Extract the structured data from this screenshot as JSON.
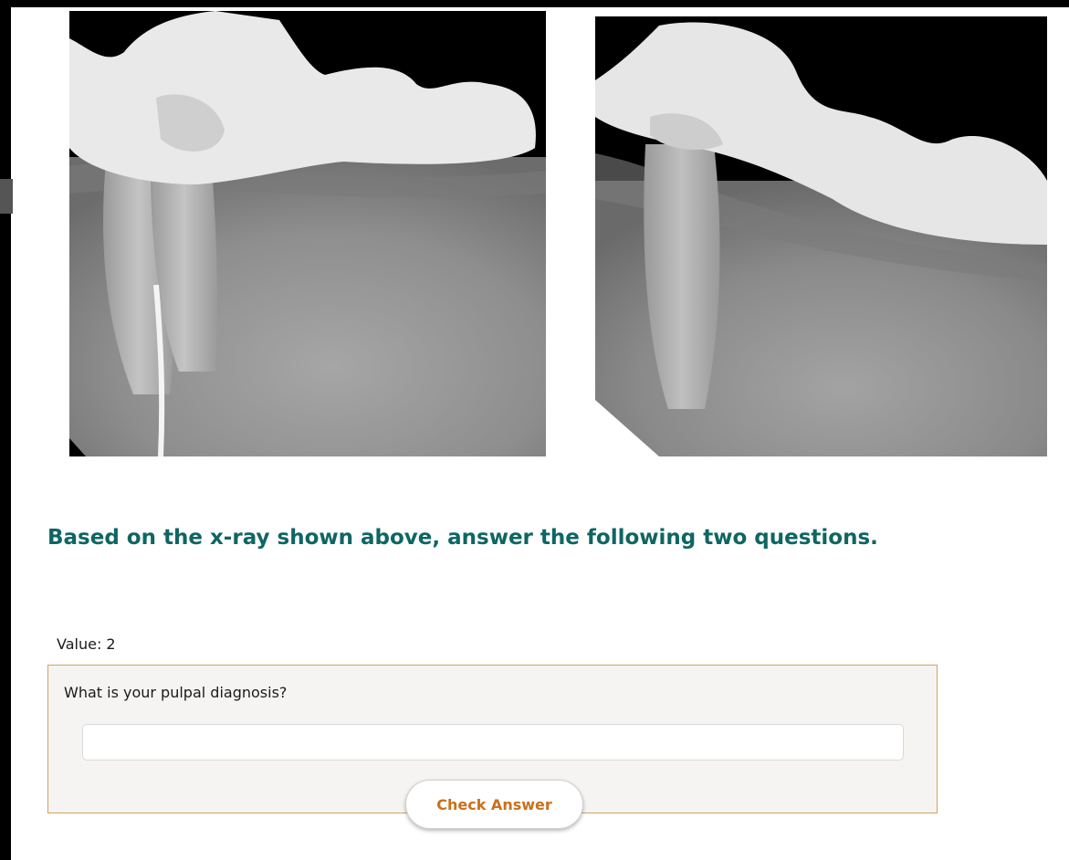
{
  "images": [
    {
      "name": "xray-left",
      "description": "periapical radiograph, crown bridge with root canal filling"
    },
    {
      "name": "xray-right",
      "description": "periapical radiograph, crown bridge, angled view"
    }
  ],
  "instruction": "Based on the x-ray shown above, answer the following two questions.",
  "question": {
    "value_label": "Value: 2",
    "prompt": "What is your pulpal diagnosis?",
    "answer_value": "",
    "answer_placeholder": "",
    "button_label": "Check Answer"
  },
  "colors": {
    "heading": "#0e6663",
    "button_text": "#c9701b",
    "box_border": "#d3a25c",
    "box_background": "#f5f4f2"
  }
}
